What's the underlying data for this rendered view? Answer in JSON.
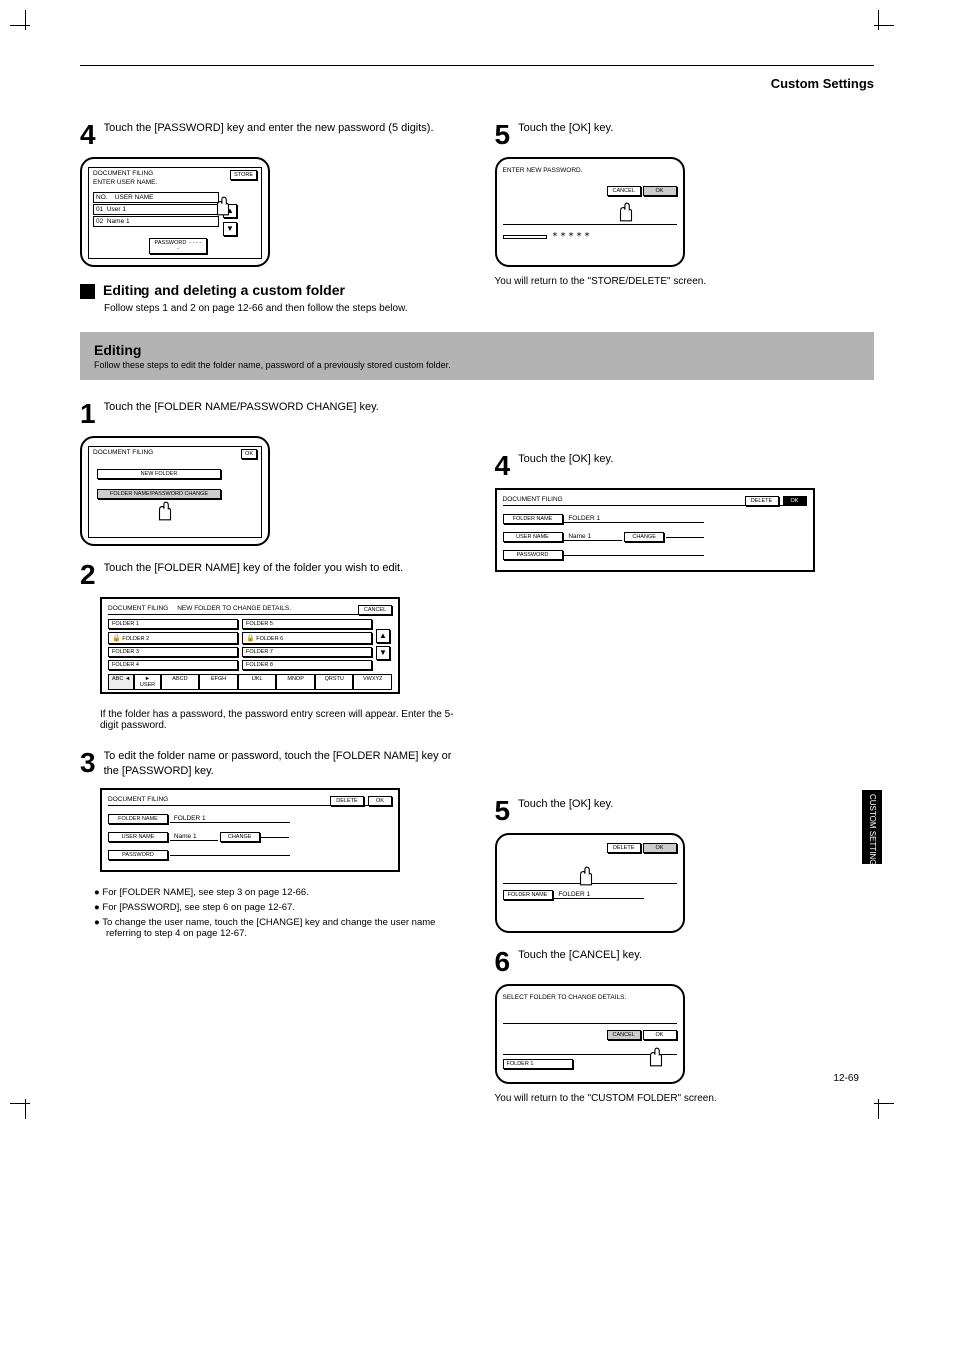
{
  "page_title": "Custom Settings",
  "page_number": "12-69",
  "side_tab": "CUSTOM SETTINGS",
  "step4": {
    "num": "4",
    "text": "Touch the [PASSWORD] key and enter the new password (5 digits).",
    "panel": {
      "title": "DOCUMENT FILING",
      "instr": "ENTER USER NAME.",
      "store_btn": "STORE",
      "col_index": "NO.",
      "col_name": "USER NAME",
      "row1_no": "01",
      "row1_user": "User 1",
      "row2_no": "02",
      "row2_user": "Name 1",
      "pw_label": "PASSWORD",
      "pw_value": "- - - - -"
    }
  },
  "step5r": {
    "num": "5",
    "text": "Touch the [OK] key.",
    "line1": "ENTER NEW PASSWORD.",
    "cancel": "CANCEL",
    "ok": "OK",
    "stars": "*****",
    "bottom_note": "You will return to the \"STORE/DELETE\" screen."
  },
  "sq_head": "Editing and deleting a custom folder",
  "sq_sub": "Follow steps 1 and 2 on page 12-66 and then follow the steps below.",
  "banner_title": "Editing",
  "banner_sub": "Follow these steps to edit the folder name, password of a previously stored custom folder.",
  "step1": {
    "num": "1",
    "text": "Touch the [FOLDER NAME/PASSWORD CHANGE] key.",
    "title": "DOCUMENT FILING",
    "ok": "OK",
    "btn1": "NEW FOLDER",
    "btn2": "FOLDER NAME/PASSWORD CHANGE"
  },
  "step2": {
    "num": "2",
    "text": "Touch the [FOLDER NAME] key of the folder you wish to edit.",
    "header_l": "DOCUMENT FILING",
    "header_r": "NEW FOLDER TO CHANGE DETAILS.",
    "cancel": "CANCEL",
    "r1c1": "FOLDER 1",
    "r1c2": "FOLDER 5",
    "r2c1": "FOLDER 2",
    "r2c2": "FOLDER 6",
    "r3c1": "FOLDER 3",
    "r3c2": "FOLDER 7",
    "r4c1": "FOLDER 4",
    "r4c2": "FOLDER 8",
    "tabs_l": "ABC",
    "tabs_r": "USER",
    "t1": "ABCD",
    "t2": "EFGH",
    "t3": "IJKL",
    "t4": "MNOP",
    "t5": "QRSTU",
    "t6": "VWXYZ",
    "password_prompt": "If the folder has a password, the password entry screen will appear. Enter the 5-digit password."
  },
  "step3": {
    "num": "3",
    "text": "To edit the folder name or password, touch the [FOLDER NAME] key or the [PASSWORD] key.",
    "title": "DOCUMENT FILING",
    "delete": "DELETE",
    "ok": "OK",
    "row_folder_label": "FOLDER NAME",
    "row_folder_val": "FOLDER 1",
    "row_user_label": "USER NAME",
    "row_user_val": "Name 1",
    "row_user_btn": "CHANGE",
    "row_pw_label": "PASSWORD",
    "notes": [
      "For [FOLDER NAME], see step 3 on page 12-66.",
      "For [PASSWORD], see step 6 on page 12-67.",
      "To change the user name, touch the [CHANGE] key and change the user name referring to step 4 on page 12-67."
    ]
  },
  "step4r": {
    "num": "4",
    "text": "Touch the [OK] key.",
    "title": "DOCUMENT FILING",
    "delete": "DELETE",
    "ok": "OK",
    "row_folder_label": "FOLDER NAME",
    "row_folder_val": "FOLDER 1",
    "row_user_label": "USER NAME",
    "row_user_val": "Name 1",
    "row_user_btn": "CHANGE",
    "row_pw_label": "PASSWORD"
  },
  "step5": {
    "num": "5",
    "text": "Touch the [OK] key.",
    "delete": "DELETE",
    "ok": "OK",
    "row_folder_label": "FOLDER NAME",
    "row_folder_val": "FOLDER 1"
  },
  "step6": {
    "num": "6",
    "text": "Touch the [CANCEL] key.",
    "line1": "SELECT FOLDER TO CHANGE DETAILS.",
    "cancel": "CANCEL",
    "ok": "OK",
    "row1": "FOLDER 1",
    "bottom": "You will return to the \"CUSTOM FOLDER\" screen."
  }
}
